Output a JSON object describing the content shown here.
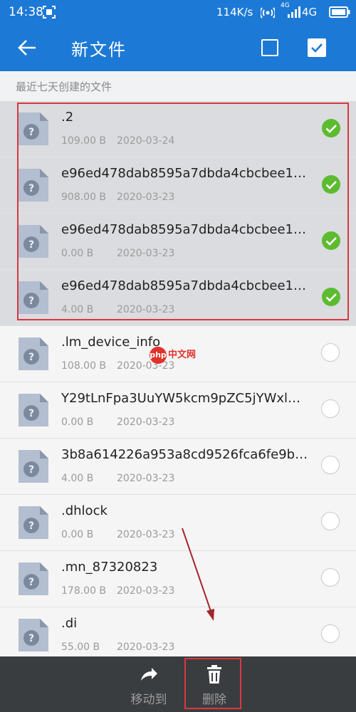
{
  "status_bar": {
    "time": "14:38",
    "speed": "114K/s",
    "signal_label_top": "4G",
    "signal_label_bottom": "",
    "network": "4G"
  },
  "app_bar": {
    "title": "新文件"
  },
  "section_header": "最近七天创建的文件",
  "files": [
    {
      "name": ".2",
      "size": "109.00 B",
      "date": "2020-03-24",
      "selected": true
    },
    {
      "name": "e96ed478dab8595a7dbda4cbcbee1…",
      "size": "908.00 B",
      "date": "2020-03-23",
      "selected": true
    },
    {
      "name": "e96ed478dab8595a7dbda4cbcbee1…",
      "size": "0.00 B",
      "date": "2020-03-23",
      "selected": true
    },
    {
      "name": "e96ed478dab8595a7dbda4cbcbee1…",
      "size": "4.00 B",
      "date": "2020-03-23",
      "selected": true
    },
    {
      "name": ".lm_device_info",
      "size": "108.00 B",
      "date": "2020-03-23",
      "selected": false
    },
    {
      "name": "Y29tLnFpa3UuYW5kcm9pZC5jYWxl…",
      "size": "0.00 B",
      "date": "2020-03-23",
      "selected": false
    },
    {
      "name": "3b8a614226a953a8cd9526fca6fe9b…",
      "size": "4.00 B",
      "date": "2020-03-23",
      "selected": false
    },
    {
      "name": ".dhlock",
      "size": "0.00 B",
      "date": "2020-03-23",
      "selected": false
    },
    {
      "name": ".mn_87320823",
      "size": "178.00 B",
      "date": "2020-03-23",
      "selected": false
    },
    {
      "name": ".di",
      "size": "55.00 B",
      "date": "2020-03-23",
      "selected": false
    }
  ],
  "watermark": {
    "badge": "php",
    "text": "中文网"
  },
  "bottom_bar": {
    "move_label": "移动到",
    "delete_label": "删除"
  },
  "colors": {
    "primary": "#1d79d6",
    "check_green": "#5dbb2f",
    "annotation_red": "#d9383f",
    "bottom_bar": "#3a3d40"
  }
}
